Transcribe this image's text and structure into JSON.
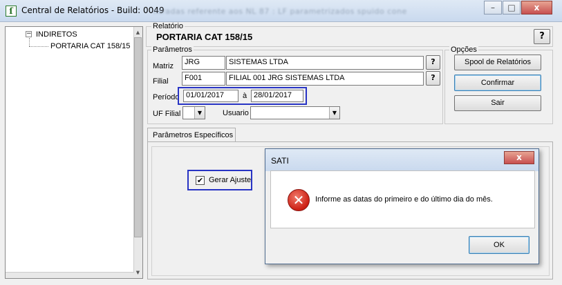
{
  "window": {
    "title": "Central de Relatórios - Build: 0049",
    "ghost_text": "ntradas referente aos NL 87 : LF parametrizados spuido cone"
  },
  "tree": {
    "root": "INDIRETOS",
    "child": "PORTARIA CAT 158/15"
  },
  "relatorio": {
    "group_label": "Relatório",
    "name": "PORTARIA CAT 158/15",
    "help": "?"
  },
  "parametros": {
    "group_label": "Parâmetros",
    "matriz_label": "Matriz",
    "matriz_code": "JRG",
    "matriz_name": "SISTEMAS LTDA",
    "filial_label": "Filial",
    "filial_code": "F001",
    "filial_name": "FILIAL 001 JRG SISTEMAS LTDA",
    "periodo_label": "Período",
    "data_inicio": "01/01/2017",
    "sep": "à",
    "data_fim": "28/01/2017",
    "uf_label": "UF Filial",
    "uf_value": "",
    "usuario_label": "Usuario",
    "usuario_value": "",
    "help": "?"
  },
  "opcoes": {
    "group_label": "Opções",
    "spool": "Spool de Relatórios",
    "confirmar": "Confirmar",
    "sair": "Sair"
  },
  "especificos": {
    "tab_label": "Parâmetros Específicos",
    "checkbox_label": "Gerar Ajuste",
    "checked": true
  },
  "dialog": {
    "title": "SATI",
    "close": "x",
    "message": "Informe as datas do primeiro e do último dia do mês.",
    "ok": "OK"
  }
}
